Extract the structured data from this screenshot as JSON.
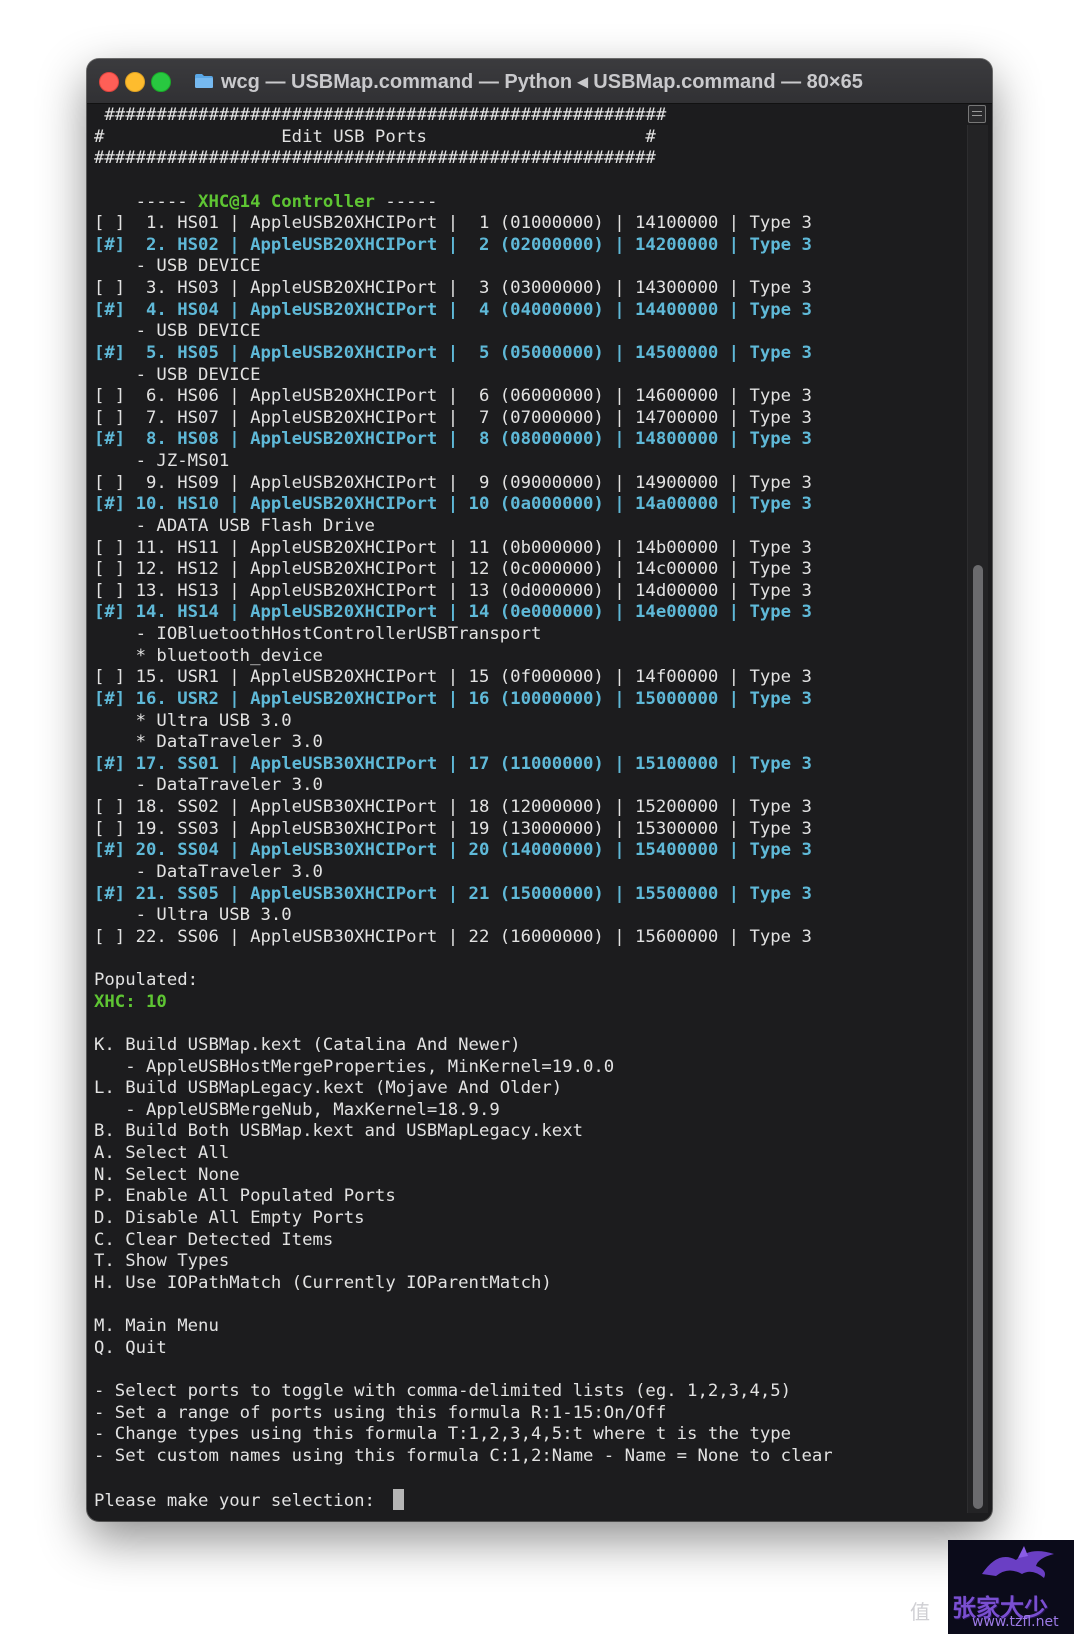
{
  "window": {
    "title": "wcg — USBMap.command — Python ◂ USBMap.command — 80×65"
  },
  "colors": {
    "highlight": "#5fb9d8",
    "heading_green": "#5ec533",
    "text": "#e2e2e2",
    "background": "#1c1c1e"
  },
  "terminal": {
    "header": [
      " ###################################################### ",
      "#                 Edit USB Ports                     #",
      "######################################################"
    ],
    "controller": {
      "prefix": "    ----- ",
      "name": "XHC@14 Controller",
      "suffix": " -----"
    },
    "ports": [
      {
        "text": "[ ]  1. HS01 | AppleUSB20XHCIPort |  1 (01000000) | 14100000 | Type 3",
        "selected": false,
        "devices": []
      },
      {
        "text": "[#]  2. HS02 | AppleUSB20XHCIPort |  2 (02000000) | 14200000 | Type 3",
        "selected": true,
        "devices": [
          "    - USB DEVICE"
        ]
      },
      {
        "text": "[ ]  3. HS03 | AppleUSB20XHCIPort |  3 (03000000) | 14300000 | Type 3",
        "selected": false,
        "devices": []
      },
      {
        "text": "[#]  4. HS04 | AppleUSB20XHCIPort |  4 (04000000) | 14400000 | Type 3",
        "selected": true,
        "devices": [
          "    - USB DEVICE"
        ]
      },
      {
        "text": "[#]  5. HS05 | AppleUSB20XHCIPort |  5 (05000000) | 14500000 | Type 3",
        "selected": true,
        "devices": [
          "    - USB DEVICE"
        ]
      },
      {
        "text": "[ ]  6. HS06 | AppleUSB20XHCIPort |  6 (06000000) | 14600000 | Type 3",
        "selected": false,
        "devices": []
      },
      {
        "text": "[ ]  7. HS07 | AppleUSB20XHCIPort |  7 (07000000) | 14700000 | Type 3",
        "selected": false,
        "devices": []
      },
      {
        "text": "[#]  8. HS08 | AppleUSB20XHCIPort |  8 (08000000) | 14800000 | Type 3",
        "selected": true,
        "devices": [
          "    - JZ-MS01"
        ]
      },
      {
        "text": "[ ]  9. HS09 | AppleUSB20XHCIPort |  9 (09000000) | 14900000 | Type 3",
        "selected": false,
        "devices": []
      },
      {
        "text": "[#] 10. HS10 | AppleUSB20XHCIPort | 10 (0a000000) | 14a00000 | Type 3",
        "selected": true,
        "devices": [
          "    - ADATA USB Flash Drive"
        ]
      },
      {
        "text": "[ ] 11. HS11 | AppleUSB20XHCIPort | 11 (0b000000) | 14b00000 | Type 3",
        "selected": false,
        "devices": []
      },
      {
        "text": "[ ] 12. HS12 | AppleUSB20XHCIPort | 12 (0c000000) | 14c00000 | Type 3",
        "selected": false,
        "devices": []
      },
      {
        "text": "[ ] 13. HS13 | AppleUSB20XHCIPort | 13 (0d000000) | 14d00000 | Type 3",
        "selected": false,
        "devices": []
      },
      {
        "text": "[#] 14. HS14 | AppleUSB20XHCIPort | 14 (0e000000) | 14e00000 | Type 3",
        "selected": true,
        "devices": [
          "    - IOBluetoothHostControllerUSBTransport",
          "    * bluetooth_device"
        ]
      },
      {
        "text": "[ ] 15. USR1 | AppleUSB20XHCIPort | 15 (0f000000) | 14f00000 | Type 3",
        "selected": false,
        "devices": []
      },
      {
        "text": "[#] 16. USR2 | AppleUSB20XHCIPort | 16 (10000000) | 15000000 | Type 3",
        "selected": true,
        "devices": [
          "    * Ultra USB 3.0",
          "    * DataTraveler 3.0"
        ]
      },
      {
        "text": "[#] 17. SS01 | AppleUSB30XHCIPort | 17 (11000000) | 15100000 | Type 3",
        "selected": true,
        "devices": [
          "    - DataTraveler 3.0"
        ]
      },
      {
        "text": "[ ] 18. SS02 | AppleUSB30XHCIPort | 18 (12000000) | 15200000 | Type 3",
        "selected": false,
        "devices": []
      },
      {
        "text": "[ ] 19. SS03 | AppleUSB30XHCIPort | 19 (13000000) | 15300000 | Type 3",
        "selected": false,
        "devices": []
      },
      {
        "text": "[#] 20. SS04 | AppleUSB30XHCIPort | 20 (14000000) | 15400000 | Type 3",
        "selected": true,
        "devices": [
          "    - DataTraveler 3.0"
        ]
      },
      {
        "text": "[#] 21. SS05 | AppleUSB30XHCIPort | 21 (15000000) | 15500000 | Type 3",
        "selected": true,
        "devices": [
          "    - Ultra USB 3.0"
        ]
      },
      {
        "text": "[ ] 22. SS06 | AppleUSB30XHCIPort | 22 (16000000) | 15600000 | Type 3",
        "selected": false,
        "devices": []
      }
    ],
    "populated_label": "Populated:",
    "populated_value": "XHC: 10",
    "menu": [
      "K. Build USBMap.kext (Catalina And Newer)",
      "   - AppleUSBHostMergeProperties, MinKernel=19.0.0",
      "L. Build USBMapLegacy.kext (Mojave And Older)",
      "   - AppleUSBMergeNub, MaxKernel=18.9.9",
      "B. Build Both USBMap.kext and USBMapLegacy.kext",
      "A. Select All",
      "N. Select None",
      "P. Enable All Populated Ports",
      "D. Disable All Empty Ports",
      "C. Clear Detected Items",
      "T. Show Types",
      "H. Use IOPathMatch (Currently IOParentMatch)"
    ],
    "menu2": [
      "M. Main Menu",
      "Q. Quit"
    ],
    "help": [
      "- Select ports to toggle with comma-delimited lists (eg. 1,2,3,4,5)",
      "- Set a range of ports using this formula R:1-15:On/Off",
      "- Change types using this formula T:1,2,3,4,5:t where t is the type",
      "- Set custom names using this formula C:1,2:Name - Name = None to clear"
    ],
    "prompt": "Please make your selection: "
  },
  "watermark": {
    "text": "张家大少",
    "url": "www.tzfl.net",
    "corner_mark": "值"
  }
}
